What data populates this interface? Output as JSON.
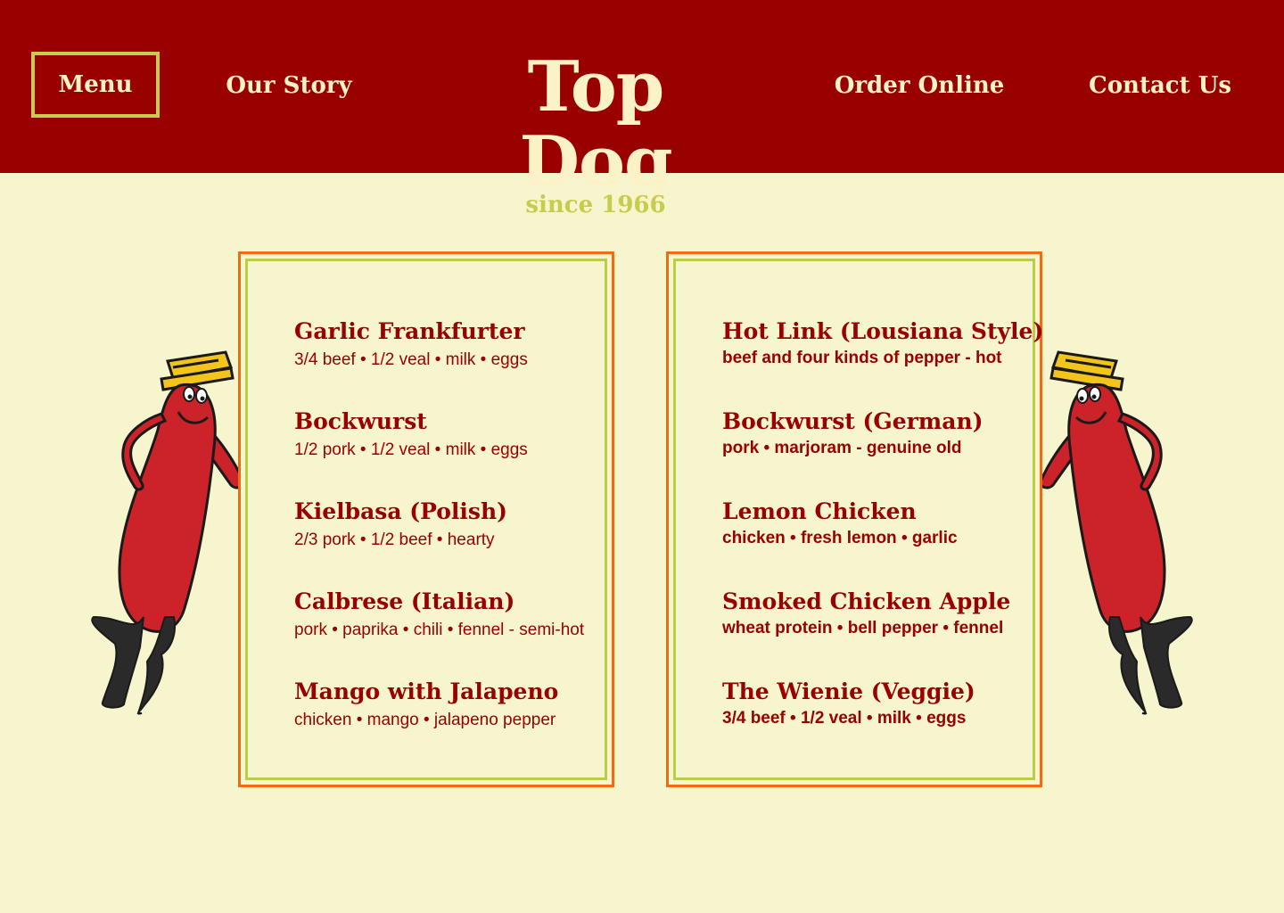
{
  "nav": {
    "menu": "Menu",
    "story": "Our Story",
    "order": "Order Online",
    "contact": "Contact Us"
  },
  "logo": {
    "title": "Top Dog",
    "subtitle": "since 1966"
  },
  "menu": {
    "left": [
      {
        "name": "Garlic Frankfurter",
        "desc": "3/4 beef • 1/2 veal • milk • eggs"
      },
      {
        "name": "Bockwurst",
        "desc": "1/2 pork • 1/2 veal • milk • eggs"
      },
      {
        "name": "Kielbasa (Polish)",
        "desc": "2/3 pork • 1/2 beef • hearty"
      },
      {
        "name": "Calbrese (Italian)",
        "desc": "pork • paprika • chili • fennel - semi-hot"
      },
      {
        "name": "Mango with Jalapeno",
        "desc": "chicken • mango • jalapeno pepper"
      }
    ],
    "right": [
      {
        "name": "Hot Link (Lousiana Style)",
        "desc": "beef and four kinds of pepper - hot"
      },
      {
        "name": "Bockwurst (German)",
        "desc": "pork • marjoram - genuine old"
      },
      {
        "name": "Lemon Chicken",
        "desc": "chicken • fresh lemon • garlic"
      },
      {
        "name": "Smoked Chicken Apple",
        "desc": "wheat protein • bell pepper • fennel"
      },
      {
        "name": "The Wienie (Veggie)",
        "desc": "3/4 beef • 1/2 veal • milk • eggs"
      }
    ]
  },
  "colors": {
    "header": "#990000",
    "background": "#f7f5cd",
    "cream": "#fbf3c7",
    "lime": "#c6cc4b",
    "orange": "#f06d14",
    "mascot_red": "#cc2229"
  },
  "icons": {
    "mascot": "hot-dog-mascot-icon"
  }
}
